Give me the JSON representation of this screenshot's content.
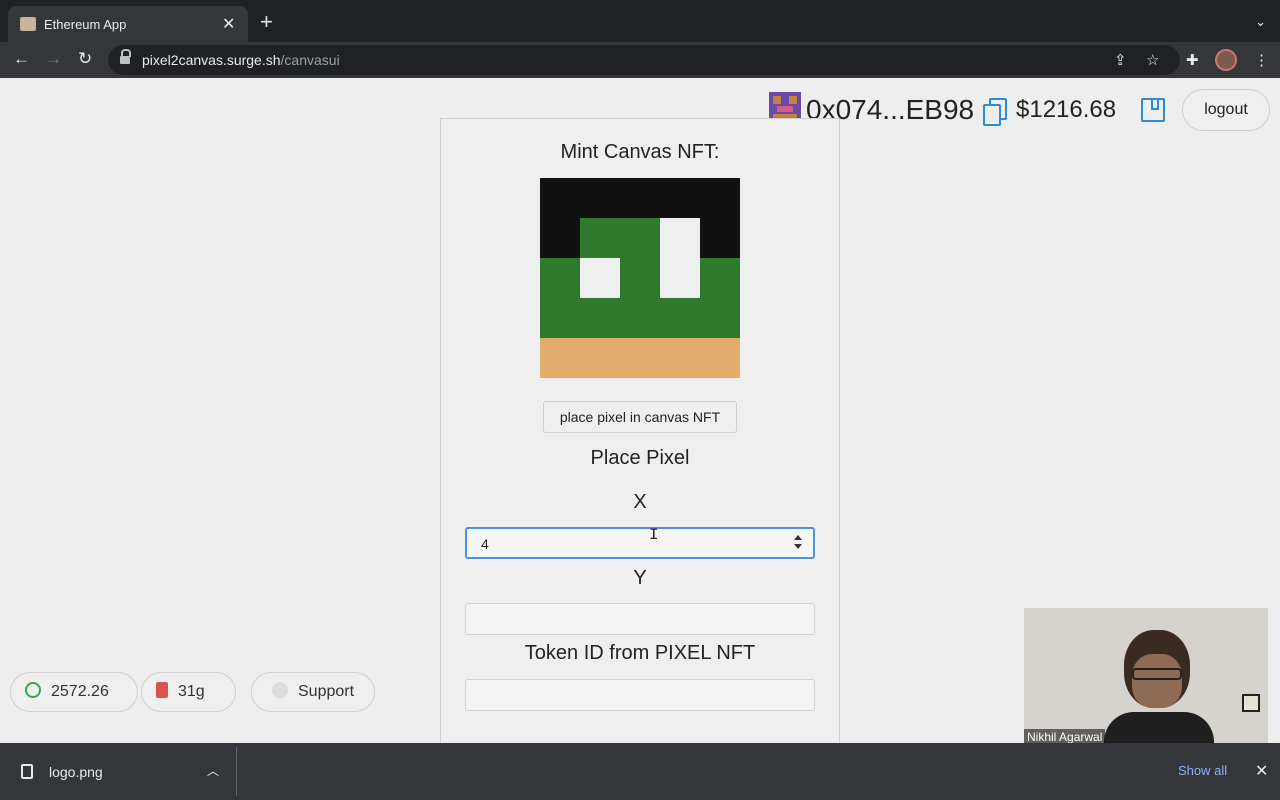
{
  "browser": {
    "tab_title": "Ethereum App",
    "close_glyph": "✕",
    "new_tab_glyph": "+",
    "menu_glyph": "⌄",
    "url_host": "pixel2canvas.surge.sh",
    "url_path": "/canvasui",
    "icons": [
      "back-icon",
      "forward-icon",
      "reload-icon",
      "lock-icon",
      "share-icon",
      "star-icon",
      "extensions-icon",
      "profile-avatar",
      "menu-icon"
    ]
  },
  "header": {
    "address": "0x074...EB98",
    "balance": "$1216.68",
    "logout_label": "logout",
    "accent_color": "#2b8bd6"
  },
  "mint": {
    "title": "Mint Canvas NFT:",
    "canvas_colors": [
      "#111111",
      "#2d7a2c",
      "#efefef",
      "#e2ad6b"
    ],
    "place_button_label": "place pixel in canvas NFT"
  },
  "place_pixel": {
    "title": "Place Pixel",
    "x_label": "X",
    "x_value": "4",
    "y_label": "Y",
    "y_value": "",
    "token_label": "Token ID from PIXEL NFT",
    "token_value": ""
  },
  "bottom_pills": {
    "coins": "2572.26",
    "grams": "31g",
    "support": "Support"
  },
  "video": {
    "participant_name": "Nikhil Agarwal"
  },
  "downloads": {
    "file_name": "logo.png",
    "show_all": "Show all"
  }
}
